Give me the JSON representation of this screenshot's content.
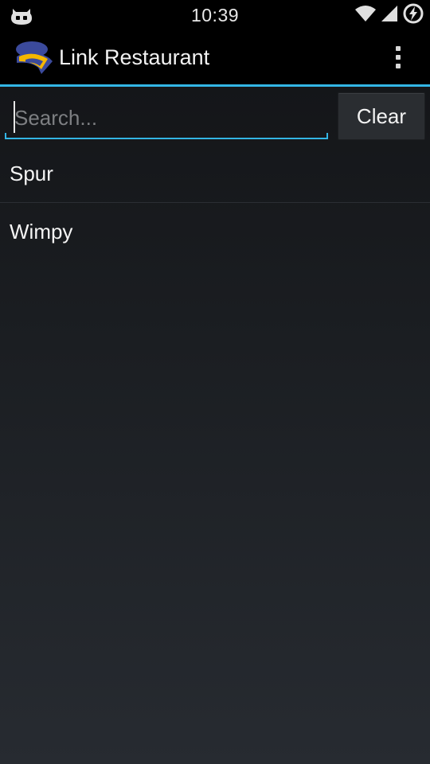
{
  "status_bar": {
    "time": "10:39",
    "left_icon": "cyanogenmod-mascot-icon",
    "right_icons": [
      "wifi-icon",
      "cell-signal-icon",
      "battery-charging-icon"
    ]
  },
  "action_bar": {
    "title": "Link Restaurant",
    "logo_icon": "restaurant-logo-icon",
    "overflow_icon": "overflow-menu-icon"
  },
  "search": {
    "placeholder": "Search...",
    "value": "",
    "clear_label": "Clear"
  },
  "restaurants": [
    {
      "name": "Spur"
    },
    {
      "name": "Wimpy"
    }
  ],
  "colors": {
    "accent": "#33b5e5",
    "status_bar_bg": "#000000",
    "action_bar_bg": "#000000",
    "logo_blue": "#3b4a9c",
    "logo_yellow": "#f5b700"
  }
}
